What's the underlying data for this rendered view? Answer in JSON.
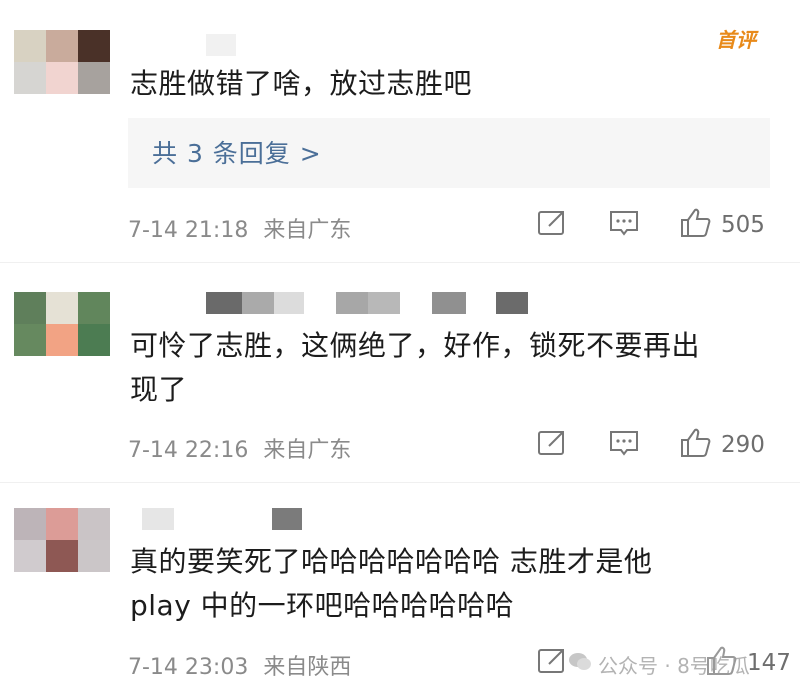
{
  "badge": "首评",
  "comments": [
    {
      "text": "志胜做错了啥，放过志胜吧",
      "reply_link": "共 3 条回复 >",
      "time": "7-14 21:18",
      "location": "来自广东",
      "likes": "505"
    },
    {
      "text_line1": "可怜了志胜，这俩绝了，好作，锁死不要再出",
      "text_line2": "现了",
      "time": "7-14 22:16",
      "location": "来自广东",
      "likes": "290"
    },
    {
      "text_line1": "真的要笑死了哈哈哈哈哈哈哈 志胜才是他",
      "text_line2": "play 中的一环吧哈哈哈哈哈哈",
      "time": "7-14 23:03",
      "location": "来自陕西",
      "likes": "147"
    }
  ],
  "watermark": "公众号 · 8号吃瓜",
  "icons": {
    "repost": "repost-icon",
    "comment": "comment-icon",
    "like": "thumbs-up-icon"
  }
}
